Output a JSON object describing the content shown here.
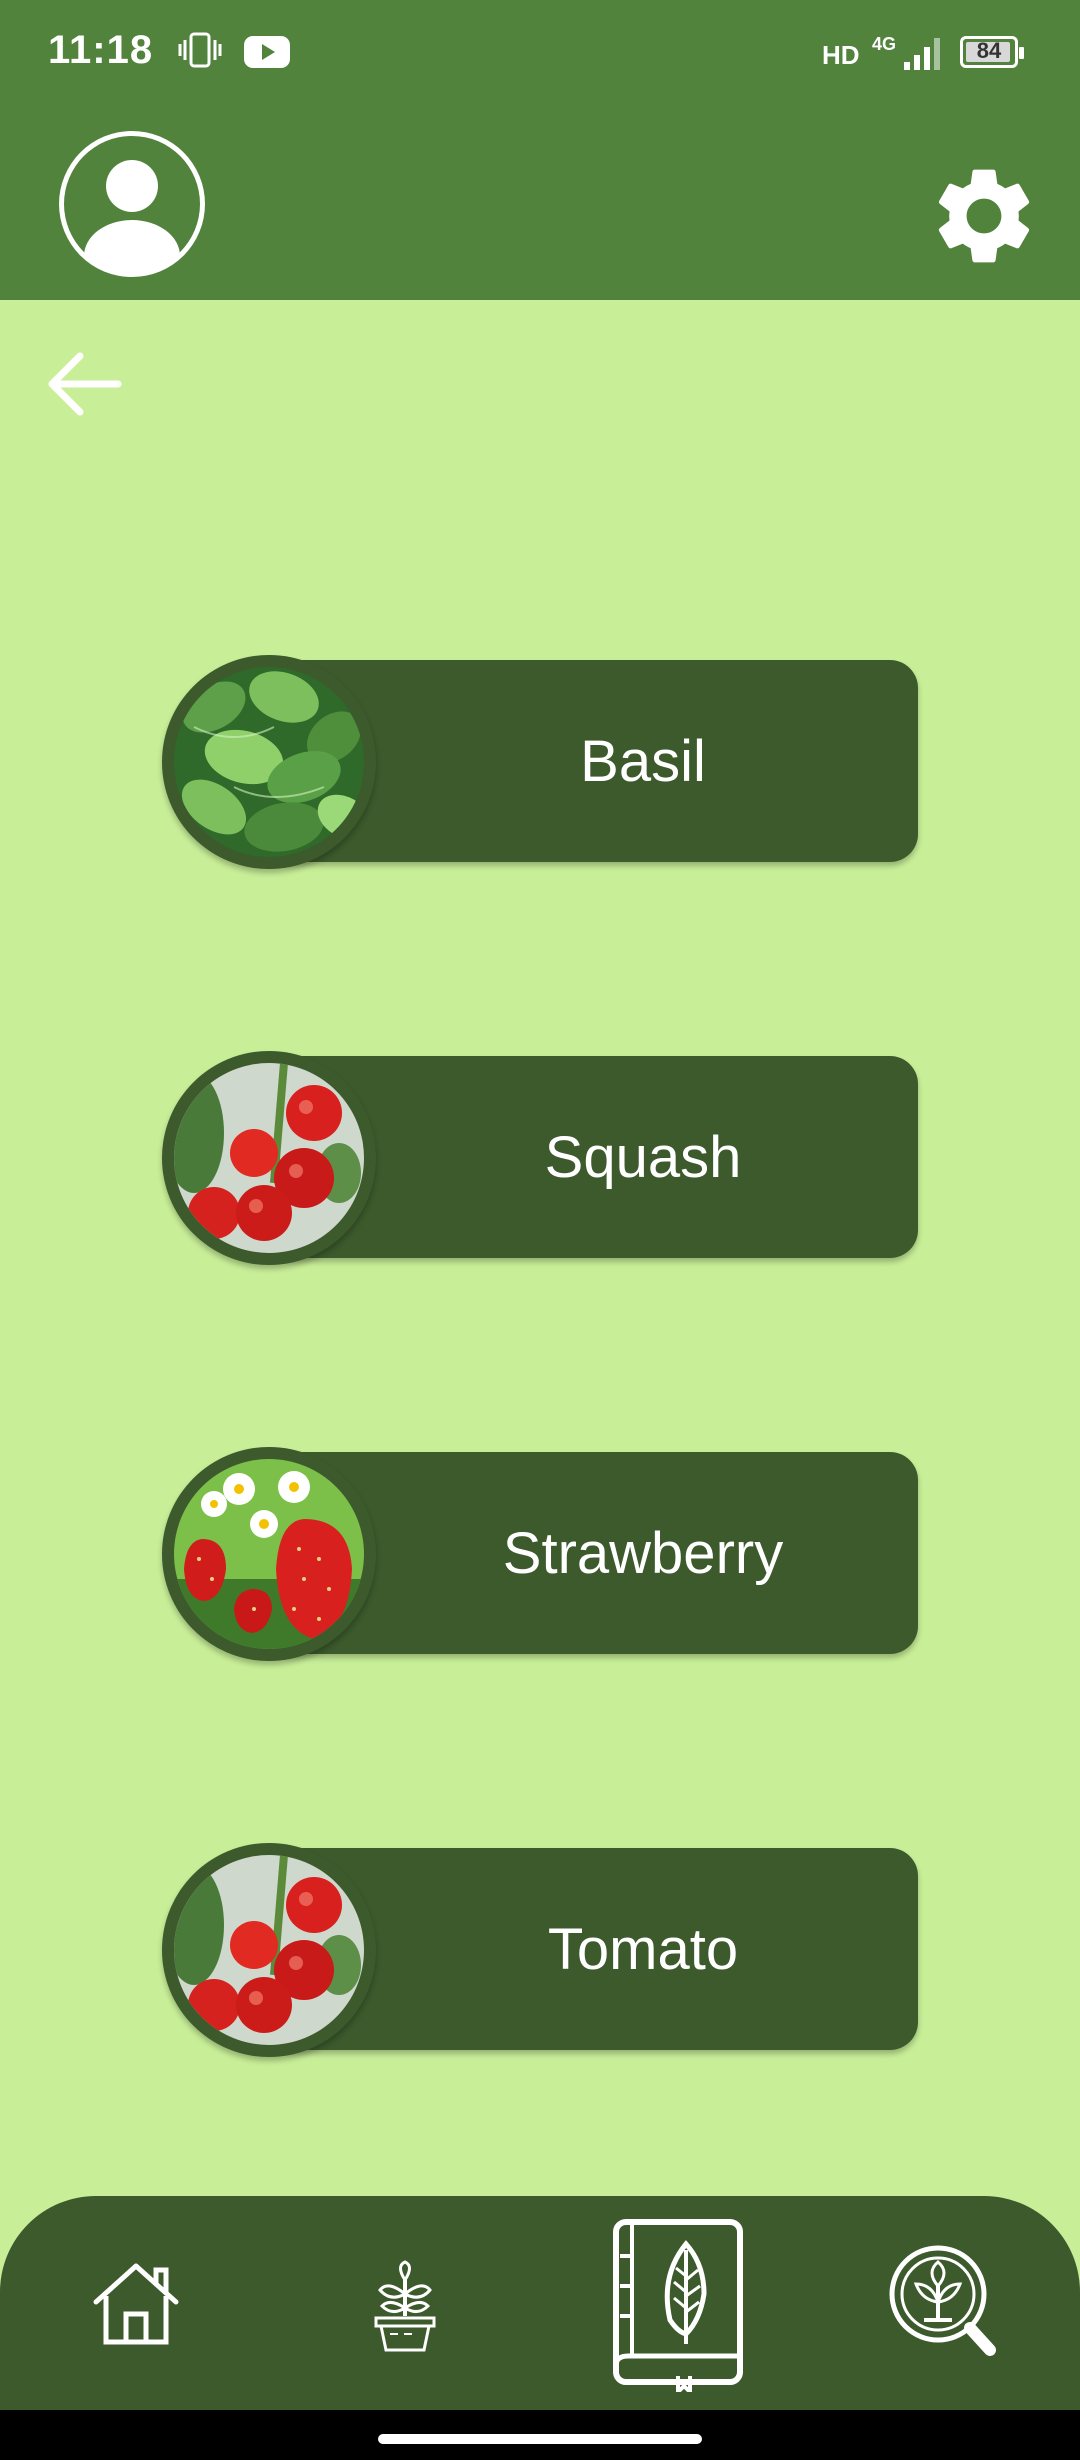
{
  "status_bar": {
    "time": "11:18",
    "network": "HD",
    "network_type": "4G",
    "battery_level": "84",
    "icons": [
      "vibrate-icon",
      "youtube-icon",
      "signal-icon",
      "battery-icon"
    ]
  },
  "header": {
    "avatar_icon": "user-avatar-icon",
    "settings_icon": "gear-icon"
  },
  "back_icon": "arrow-left-icon",
  "plants": [
    {
      "label": "Basil",
      "image": "basil-photo"
    },
    {
      "label": "Squash",
      "image": "tomato-vine-photo"
    },
    {
      "label": "Strawberry",
      "image": "strawberry-photo"
    },
    {
      "label": "Tomato",
      "image": "tomato-vine-photo"
    }
  ],
  "bottom_nav": [
    {
      "icon": "home-icon",
      "active": false
    },
    {
      "icon": "potted-plant-icon",
      "active": false
    },
    {
      "icon": "leaf-book-icon",
      "active": true
    },
    {
      "icon": "plant-search-icon",
      "active": false
    }
  ],
  "colors": {
    "background": "#c8ef98",
    "header": "#51833c",
    "card": "#3c5a2c",
    "text": "#ffffff"
  }
}
